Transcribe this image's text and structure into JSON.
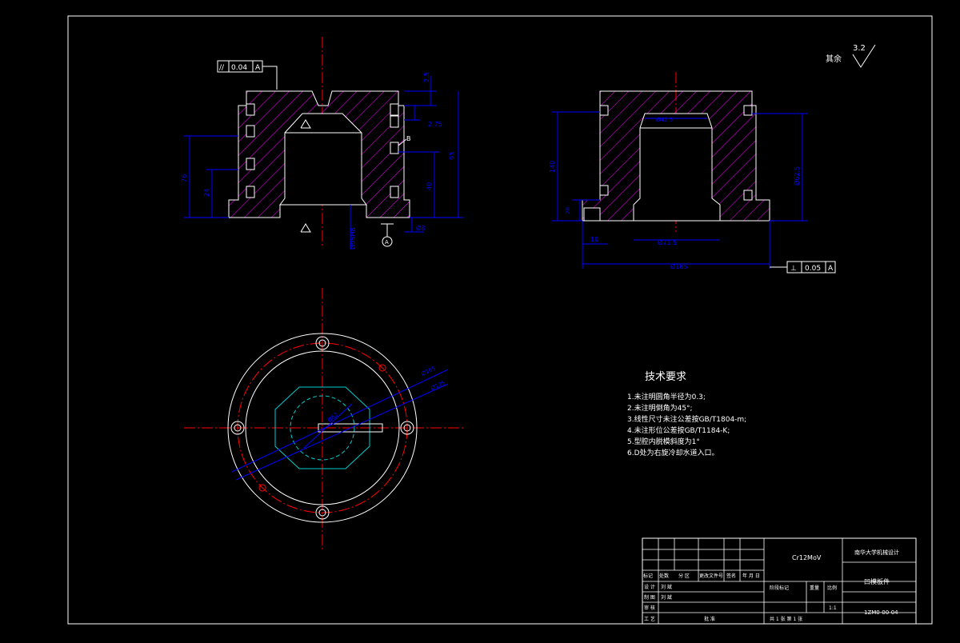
{
  "roughness": {
    "label": "其余",
    "value": "3.2"
  },
  "left_view": {
    "parallel_frame": {
      "symbol": "//",
      "tolerance": "0.04",
      "datum": "A"
    },
    "datum_label": "A",
    "callout_b": "B",
    "dims": {
      "d_top_small": "2.5",
      "d_right_a": "2.75",
      "d_right_b": "50",
      "d_right_c": "93",
      "d_right_d": "40",
      "d_left_a": "76",
      "d_left_b": "24",
      "d_bottom": "Ø95H8",
      "d_bottom2": "Ø8"
    }
  },
  "right_view": {
    "perp_frame": {
      "symbol": "⊥",
      "tolerance": "0.05",
      "datum": "A"
    },
    "dims": {
      "height": "140",
      "inner_height": "Ø62.5",
      "inner_top": "Ø42.5",
      "bottom_bore": "Ø71.5",
      "left_small": "28",
      "left_step": "10",
      "width": "Ø165"
    }
  },
  "plan_view": {
    "dims": {
      "outer": "Ø165",
      "pcd": "Ø125",
      "hex": "Ø62"
    }
  },
  "tech_notes": {
    "title": "技术要求",
    "items": [
      "1.未注明圆角半径为0.3;",
      "2.未注明倒角为45°;",
      "3.线性尺寸未注公差按GB/T1804-m;",
      "4.未注形位公差按GB/T1184-K;",
      "5.型腔内脱模斜度为1°",
      "6.D处为右旋冷却水道入口。"
    ]
  },
  "title_block": {
    "material": "Cr12MoV",
    "university": "南华大学机械设计",
    "part_name": "凹模板件",
    "drawing_no": "1ZM0-00-04",
    "scale_label": "比例",
    "scale": "1:1",
    "mass_label": "重量",
    "stage_label": "阶段标记",
    "sheets": "共 1 张   第 1 张",
    "headers": [
      "标记",
      "处数",
      "分 区",
      "更改文件号",
      "签名",
      "年 月 日"
    ],
    "row_design": "设 计",
    "row_design_name": "刘 斌",
    "row_check": "制 图",
    "row_check_name": "刘 斌",
    "row_review": "审 核",
    "row_process": "工 艺",
    "row_approve": "批 准"
  },
  "colors": {
    "outline": "#ffffff",
    "hatch": "#ff00ff",
    "center": "#ff0000",
    "dim": "#0000ff",
    "plan_hex": "#00cccc"
  }
}
